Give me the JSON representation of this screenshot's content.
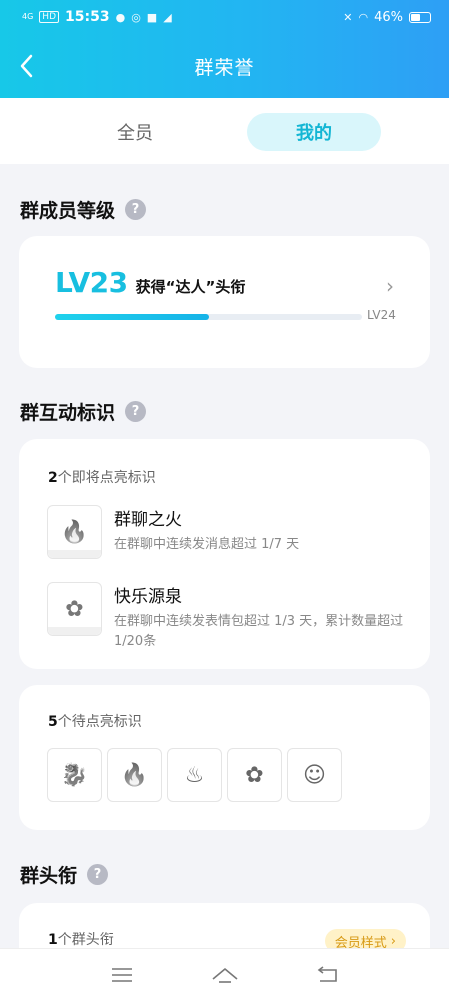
{
  "status_bar": {
    "network": "4G",
    "hd_label": "HD",
    "time": "15:53",
    "battery": "46%"
  },
  "header": {
    "title": "群荣誉"
  },
  "tabs": [
    {
      "label": "全员",
      "active": false
    },
    {
      "label": "我的",
      "active": true
    }
  ],
  "level_section": {
    "title": "群成员等级",
    "level": "LV23",
    "description": "获得“达人”头衔",
    "progress": 0.5,
    "next_level": "LV24"
  },
  "interaction_section": {
    "title": "群互动标识",
    "upcoming": {
      "count": "2",
      "label": "个即将点亮标识",
      "items": [
        {
          "icon": "fire-icon",
          "name": "群聊之火",
          "desc": "在群聊中连续发消息超过 1/7 天"
        },
        {
          "icon": "flower-icon",
          "name": "快乐源泉",
          "desc": "在群聊中连续发表情包超过 1/3 天，累计数量超过 1/20条"
        }
      ]
    },
    "pending": {
      "count": "5",
      "label": "个待点亮标识",
      "icons": [
        "dragon-icon",
        "fire-icon",
        "bonfire-icon",
        "flower-icon",
        "elder-icon"
      ]
    }
  },
  "title_section": {
    "title": "群头衔",
    "count": "1",
    "label": "个群头衔",
    "vip_tag": "会员样式"
  },
  "colors": {
    "accent": "#18bfe0",
    "vip": "#d79a16"
  }
}
